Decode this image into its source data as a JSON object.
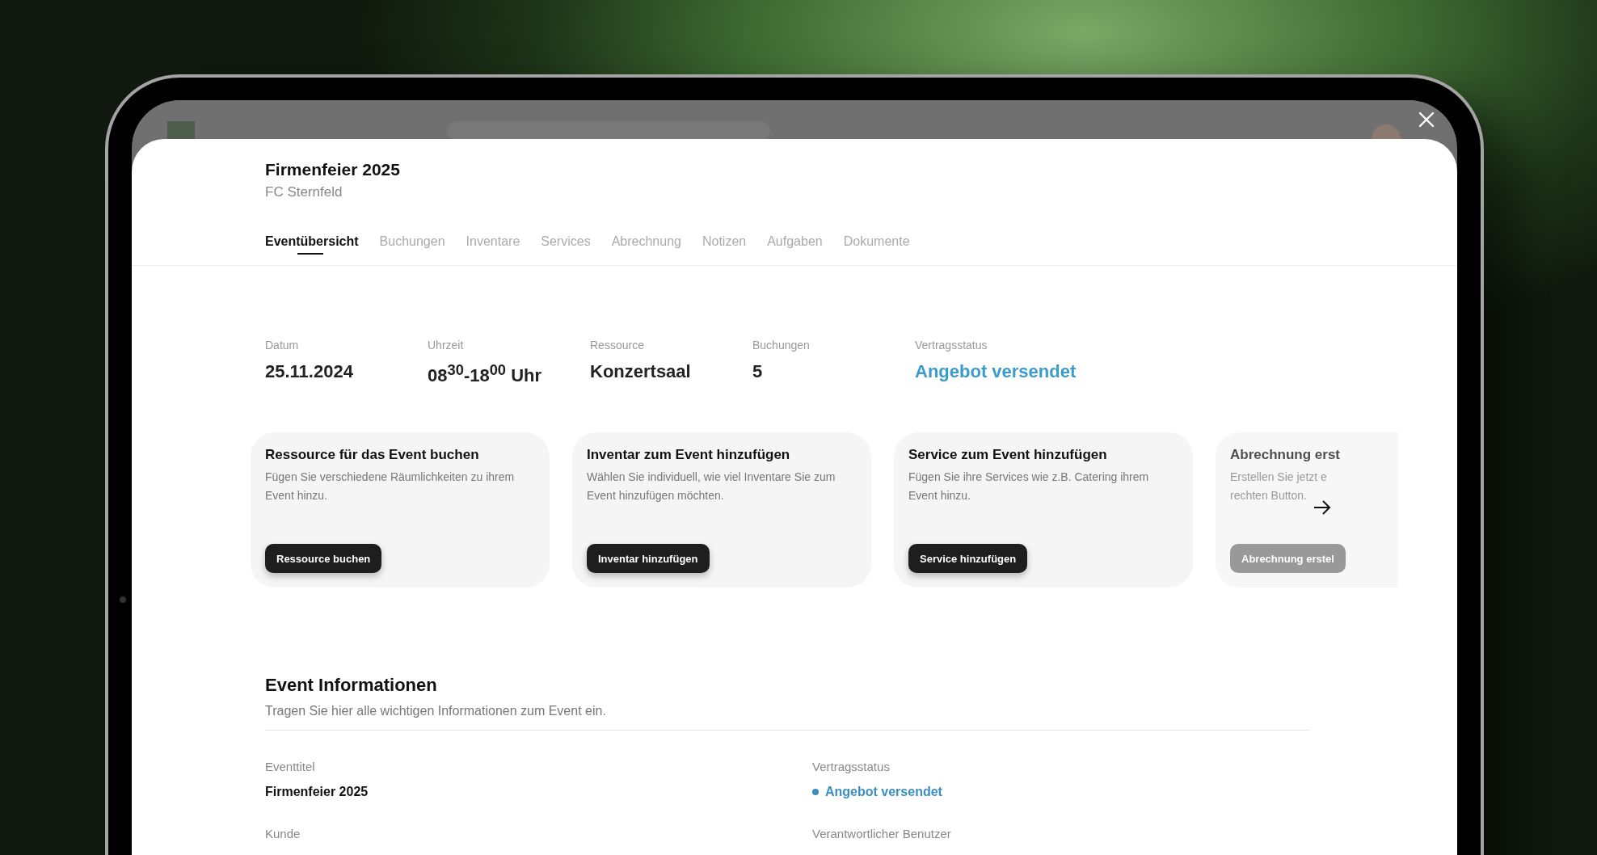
{
  "event": {
    "title": "Firmenfeier 2025",
    "subtitle": "FC Sternfeld"
  },
  "tabs": [
    {
      "label": "Eventübersicht",
      "selected": true
    },
    {
      "label": "Buchungen",
      "selected": false
    },
    {
      "label": "Inventare",
      "selected": false
    },
    {
      "label": "Services",
      "selected": false
    },
    {
      "label": "Abrechnung",
      "selected": false
    },
    {
      "label": "Notizen",
      "selected": false
    },
    {
      "label": "Aufgaben",
      "selected": false
    },
    {
      "label": "Dokumente",
      "selected": false
    }
  ],
  "stats": [
    {
      "label": "Datum",
      "value": "25.11.2024",
      "kind": "plain"
    },
    {
      "label": "Uhrzeit",
      "value": "08$^{30}$-18$^{00}$ Uhr",
      "kind": "plain"
    },
    {
      "label": "Ressource",
      "value": "Konzertsaal",
      "kind": "plain"
    },
    {
      "label": "Buchungen",
      "value": "5",
      "kind": "plain"
    },
    {
      "label": "Vertragsstatus",
      "value": "Angebot versendet",
      "kind": "status"
    }
  ],
  "cards": [
    {
      "kind": "full",
      "title": "Ressource für das Event buchen",
      "lines": [
        "Fügen Sie verschiedene Räumlichkeiten zu ihrem",
        "Event hinzu."
      ],
      "button": "Ressource buchen"
    },
    {
      "kind": "full",
      "title": "Inventar zum Event hinzufügen",
      "lines": [
        "Wählen Sie individuell, wie viel Inventare Sie zum",
        "Event hinzufügen möchten."
      ],
      "button": "Inventar hinzufügen"
    },
    {
      "kind": "full",
      "title": "Service zum Event hinzufügen",
      "lines": [
        "Fügen Sie ihre Services wie z.B. Catering ihrem",
        "Event hinzu."
      ],
      "button": "Service hinzufügen"
    },
    {
      "kind": "faded",
      "title": "Abrechnung erst",
      "lines": [
        "Erstellen Sie jetzt e",
        "rechten Button."
      ],
      "button": "Abrechnung erstel"
    }
  ],
  "info": {
    "title": "Event Informationen",
    "description": "Tragen Sie hier alle wichtigen Informationen zum Event ein.",
    "fields": [
      {
        "label": "Eventtitel",
        "value": "Firmenfeier 2025",
        "kind": "plain"
      },
      {
        "label": "Vertragsstatus",
        "value": "Angebot versendet",
        "kind": "status"
      },
      {
        "label": "Kunde"
      },
      {
        "label": "Verantwortlicher Benutzer"
      }
    ]
  }
}
